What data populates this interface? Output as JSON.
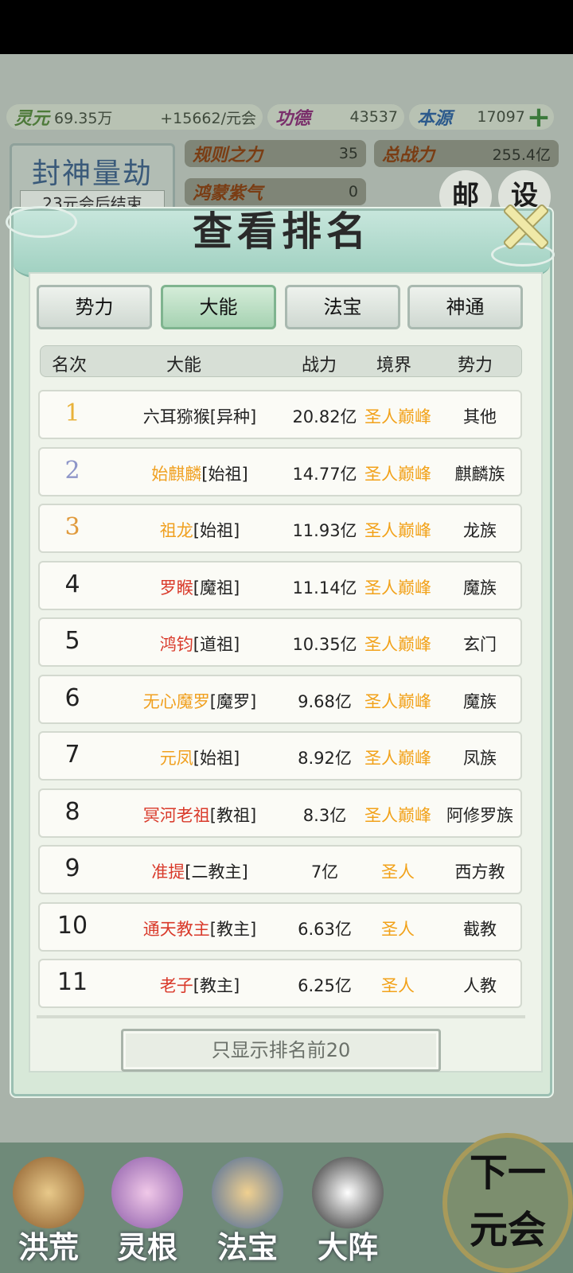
{
  "resources": {
    "lingyuan": {
      "label": "灵元",
      "value": "69.35万",
      "rate": "+15662/元会"
    },
    "gongde": {
      "label": "功德",
      "value": "43537"
    },
    "benyuan": {
      "label": "本源",
      "value": "17097"
    },
    "guize": {
      "label": "规则之力",
      "value": "35"
    },
    "zongzhanli": {
      "label": "总战力",
      "value": "255.4亿"
    },
    "hongmeng": {
      "label": "鸿蒙紫气",
      "value": "0"
    }
  },
  "event": {
    "title": "封神量劫",
    "subtitle": "23元会后结束"
  },
  "side_buttons": [
    "邮",
    "设"
  ],
  "modal": {
    "title": "查看排名",
    "tabs": [
      {
        "label": "势力",
        "active": false
      },
      {
        "label": "大能",
        "active": true
      },
      {
        "label": "法宝",
        "active": false
      },
      {
        "label": "神通",
        "active": false
      }
    ],
    "columns": [
      "名次",
      "大能",
      "战力",
      "境界",
      "势力"
    ],
    "rows": [
      {
        "rank": "1",
        "name": "六耳猕猴",
        "tag": "[异种]",
        "name_color": "#222222",
        "power": "20.82亿",
        "realm": "圣人巅峰",
        "faction": "其他"
      },
      {
        "rank": "2",
        "name": "始麒麟",
        "tag": "[始祖]",
        "name_color": "#f0a020",
        "power": "14.77亿",
        "realm": "圣人巅峰",
        "faction": "麒麟族"
      },
      {
        "rank": "3",
        "name": "祖龙",
        "tag": "[始祖]",
        "name_color": "#f0a020",
        "power": "11.93亿",
        "realm": "圣人巅峰",
        "faction": "龙族"
      },
      {
        "rank": "4",
        "name": "罗睺",
        "tag": "[魔祖]",
        "name_color": "#d93a2b",
        "power": "11.14亿",
        "realm": "圣人巅峰",
        "faction": "魔族"
      },
      {
        "rank": "5",
        "name": "鸿钧",
        "tag": "[道祖]",
        "name_color": "#d93a2b",
        "power": "10.35亿",
        "realm": "圣人巅峰",
        "faction": "玄门"
      },
      {
        "rank": "6",
        "name": "无心魔罗",
        "tag": "[魔罗]",
        "name_color": "#f0a020",
        "power": "9.68亿",
        "realm": "圣人巅峰",
        "faction": "魔族"
      },
      {
        "rank": "7",
        "name": "元凤",
        "tag": "[始祖]",
        "name_color": "#f0a020",
        "power": "8.92亿",
        "realm": "圣人巅峰",
        "faction": "凤族"
      },
      {
        "rank": "8",
        "name": "冥河老祖",
        "tag": "[教祖]",
        "name_color": "#d93a2b",
        "power": "8.3亿",
        "realm": "圣人巅峰",
        "faction": "阿修罗族"
      },
      {
        "rank": "9",
        "name": "准提",
        "tag": "[二教主]",
        "name_color": "#d93a2b",
        "power": "7亿",
        "realm": "圣人",
        "faction": "西方教"
      },
      {
        "rank": "10",
        "name": "通天教主",
        "tag": "[教主]",
        "name_color": "#d93a2b",
        "power": "6.63亿",
        "realm": "圣人",
        "faction": "截教"
      },
      {
        "rank": "11",
        "name": "老子",
        "tag": "[教主]",
        "name_color": "#d93a2b",
        "power": "6.25亿",
        "realm": "圣人",
        "faction": "人教"
      }
    ],
    "footer_button": "只显示排名前20"
  },
  "bottom_nav": [
    {
      "label": "洪荒",
      "icon": "mountain-icon"
    },
    {
      "label": "灵根",
      "icon": "lotus-icon"
    },
    {
      "label": "法宝",
      "icon": "treasure-icon"
    },
    {
      "label": "大阵",
      "icon": "taiji-icon"
    }
  ],
  "next_button": {
    "line1": "下一",
    "line2": "元会"
  },
  "colors": {
    "realm": "#f2a21a",
    "rank_1": "#e8b23a",
    "rank_2": "#8d95c8",
    "rank_3": "#e09a3c"
  }
}
